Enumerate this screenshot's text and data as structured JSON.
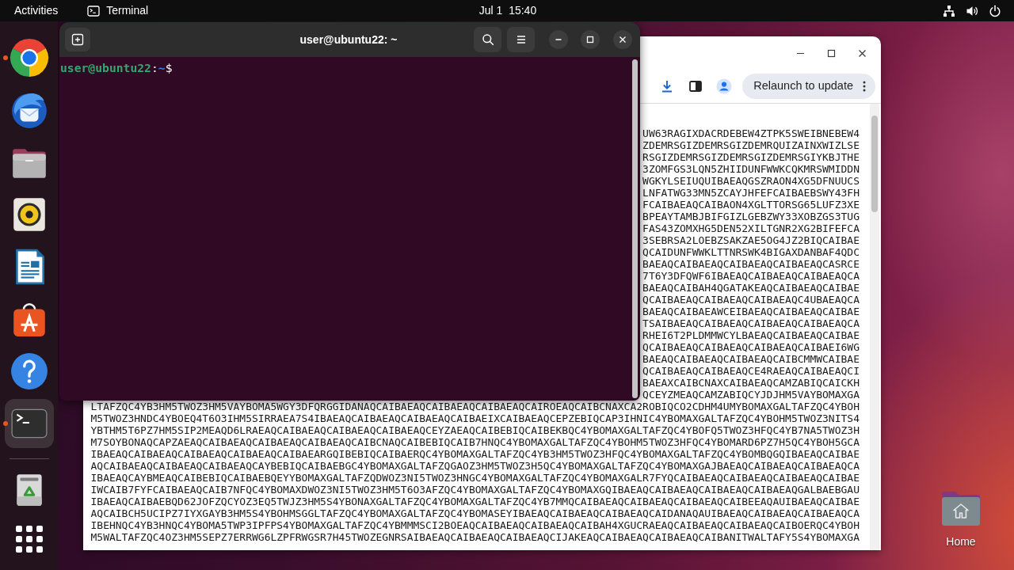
{
  "top_bar": {
    "activities": "Activities",
    "app_menu": "Terminal",
    "clock": "Jul 1  15:40"
  },
  "dock": {
    "items": [
      {
        "running": true,
        "selected": false
      },
      {
        "running": false,
        "selected": false
      },
      {
        "running": false,
        "selected": false
      },
      {
        "running": false,
        "selected": false
      },
      {
        "running": false,
        "selected": false
      },
      {
        "running": false,
        "selected": false
      },
      {
        "running": false,
        "selected": false
      },
      {
        "running": true,
        "selected": true
      }
    ]
  },
  "terminal": {
    "title": "user@ubuntu22: ~",
    "prompt": [
      {
        "kind": "user_host",
        "text": "user@ubuntu22"
      },
      {
        "kind": "plain",
        "text": ":"
      },
      {
        "kind": "path",
        "text": "~"
      },
      {
        "kind": "plain",
        "text": "$"
      }
    ]
  },
  "browser": {
    "relaunch_button": "Relaunch to update",
    "lines": [
      "UW63RAGIXDACRDEBEW4ZTPK5SWEIBNEBEW4",
      "ZDEMRSGIZDEMRSGIZDEMRQUIZAINXWIZLSE",
      "RSGIZDEMRSGIZDEMRSGIZDEMRSGIYKBJTHE",
      "3ZOMFGS3LQN5ZHIIDUNFWWKCQKMRSWMIDDN",
      "WGKYLSEIUQUIBAEAQGSZRAON4XG5DFNUUCS",
      "LNFATWG33MN5ZCAYJHFEFCAIBAEBSWY43FH",
      "FCAIBAEAQCAIBAON4XGLTTORSG65LUFZ3XE",
      "BPEAYTAMBJBIFGIZLGEBZWY33XOBZGS3TUG",
      "FAS43ZOMXHG5DEN52XILTGNR2XG2BIFEFCA",
      "3SEBRSA2LOEBZSAKZAE5OG4JZ2BIQCAIBAE",
      "QCAIDUNFWWKLTTNRSWK4BIGAXDANBAF4QDC",
      "BAEAQCAIBAEAQCAIBAEAQCAIBAEAQCASRCE",
      "7T6Y3DFQWF6IBAEAQCAIBAEAQCAIBAEAQCA",
      "BAEAQCAIBAH4QGATAKEAQCAIBAEAQCAIBAE",
      "QCAIBAEAQCAIBAEAQCAIBAEAQC4UBAEAQCA",
      "BAEAQCAIBAEAWCEIBAEAQCAIBAEAQCAIBAE",
      "TSAIBAEAQCAIBAEAQCAIBAEAQCAIBAEAQCA",
      "RHEI6T2PLDMMWCYLBAEAQCAIBAEAQCAIBAE",
      "QCAIBAEAQCAIBAEAQCAIBAEAQCAIBAEI6WG",
      "BAEAQCAIBAEAQCAIBAEAQCAIBCMMWCAIBAE",
      "QCAIBAEAQCAIBAEAQCE4RAEAQCAIBAEAQCI",
      "BAEAXCAIBCNAXCAIBAEAQCAMZABIQCAICKH",
      "QCEYZMEAQCAMZABIQCYJDJHM5VAYBOMAXGA",
      "LTAFZQC4YB3HM5TWOZ3HM5VAYBOMA5WGY3DFQRGGIDANAQCAIBAEAQCAIBAEAQCAIBAEAQCAIROEAQCAIBCNAXCA2ROBIQCO2CDHM4UMYBOMAXGALTAFZQC4YBOH",
      "M5TWOZ3HNDC4YBOEQ4T6O3IHM5SIRRAEA7S4IBAEAQCAIBAEAQCAIBAEAQCAIBAEIXCAIBAEAQCEPZEBIQCAP3IHNIC4YBOMAXGALTAFZQC4YBOHM5TWOZ3NITS4",
      "YBTHM5T6PZ7HM5SIP2MEAQD6LRAEAQCAIBAEAQCAIBAEAQCAIBAEAQCEYZAEAQCAIBEBIQCAIBEKBQC4YBOMAXGALTAFZQC4YBOFQ5TWOZ3HFQC4YB7NA5TWOZ3H",
      "M7SOYBONAQCAPZAEAQCAIBAEAQCAIBAEAQCAIBAEAQCAIBCNAQCAIBEBIQCAIB7HNQC4YBOMAXGALTAFZQC4YBOHM5TWOZ3HFQC4YBOMARD6PZ7H5QC4YBOH5GCA",
      "IBAEAQCAIBAEAQCAIBAEAQCAIBAEAQCAIBAEARGQIBEBIQCAIBAERQC4YBOMAXGALTAFZQC4YB3HM5TWOZ3HFQC4YBOMAXGALTAFZQC4YBOMBQGQIBAEAQCAIBAE",
      "AQCAIBAEAQCAIBAEAQCAIBAEAQCAYBEBIQCAIBAEBGC4YBOMAXGALTAFZQGAOZ3HM5TWOZ3H5QC4YBOMAXGALTAFZQC4YBOMAXGAJBAEAQCAIBAEAQCAIBAEAQCA",
      "IBAEAQCAYBMEAQCAIBEBIQCAIBAEBQEYYBOMAXGALTAFZQDWOZ3NI5TWOZ3HNGC4YBOMAXGALTAFZQC4YBOMAXGALR7FYQCAIBAEAQCAIBAEAQCAIBAEAQCAIBAE",
      "IWCAIB7FYFCAIBAEAQCAIB7NFQC4YBOMAXDWOZ3NI5TWOZ3HM5T6O3AFZQC4YBOMAXGALTAFZQC4YBOMAXGQIBAEAQCAIBAEAQCAIBAEAQCAIBAEAQGALBAEBGAU",
      "IBAEAQCAIBAEBQD62JOFZQCYOZ3EQ5TWJZ3HM5S4YBONAXGALTAFZQC4YBOMAXGALTAFZQC4YB7MMQCAIBAEAQCAIBAEAQCAIBAEAQCAIBEEAQAUIBAEAQCAIBAE",
      "AQCAIBCH5UCIPZ7IYXGAYB3HM5S4YBOHMSGGLTAFZQC4YBOMAXGALTAFZQC4YBOMASEYIBAEAQCAIBAEAQCAIBAEAQCAIDANAQAUIBAEAQCAIBAEAQCAIBAEAQCA",
      "IBEHNQC4YB3HNQC4YBOMA5TWP3IPFPS4YBOMAXGALTAFZQC4YBMMMSCI2BOEAQCAIBAEAQCAIBAEAQCAIBAH4XGUCRAEAQCAIBAEAQCAIBAEAQCAIBOERQC4YBOH",
      "M5WALTAFZQC4OZ3HM5SEPZ7ERRWG6LZPFRWGSR7H45TWOZEGNRSAIBAEAQCAIBAEAQCAIBAEAQCIJAKEAQCAIBAEAQCAIBAEAQCAIBANITWALTAFY5S4YBOMAXGA"
    ]
  },
  "desktop": {
    "icons": [
      {
        "label": "Home"
      }
    ]
  }
}
